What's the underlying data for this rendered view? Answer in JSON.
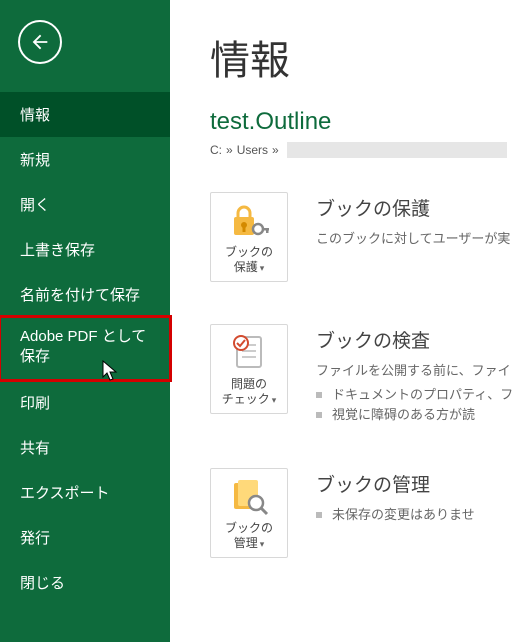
{
  "sidebar": {
    "items": [
      {
        "label": "情報",
        "active": true
      },
      {
        "label": "新規"
      },
      {
        "label": "開く"
      },
      {
        "label": "上書き保存"
      },
      {
        "label": "名前を付けて保存"
      },
      {
        "label": "Adobe PDF として保存",
        "highlight": true
      },
      {
        "label": "印刷"
      },
      {
        "label": "共有"
      },
      {
        "label": "エクスポート"
      },
      {
        "label": "発行"
      },
      {
        "label": "閉じる"
      }
    ]
  },
  "main": {
    "title": "情報",
    "filename": "test.Outline",
    "breadcrumb": {
      "part1": "C:",
      "sep": "»",
      "part2": "Users",
      "sep2": "»"
    },
    "sections": {
      "protect": {
        "btn_line1": "ブックの",
        "btn_line2": "保護",
        "title": "ブックの保護",
        "desc": "このブックに対してユーザーが実"
      },
      "inspect": {
        "btn_line1": "問題の",
        "btn_line2": "チェック",
        "title": "ブックの検査",
        "desc": "ファイルを公開する前に、ファイ",
        "bullets": [
          "ドキュメントのプロパティ、フ",
          "視覚に障碍のある方が読"
        ]
      },
      "manage": {
        "btn_line1": "ブックの",
        "btn_line2": "管理",
        "title": "ブックの管理",
        "bullets": [
          "未保存の変更はありませ"
        ]
      }
    }
  }
}
